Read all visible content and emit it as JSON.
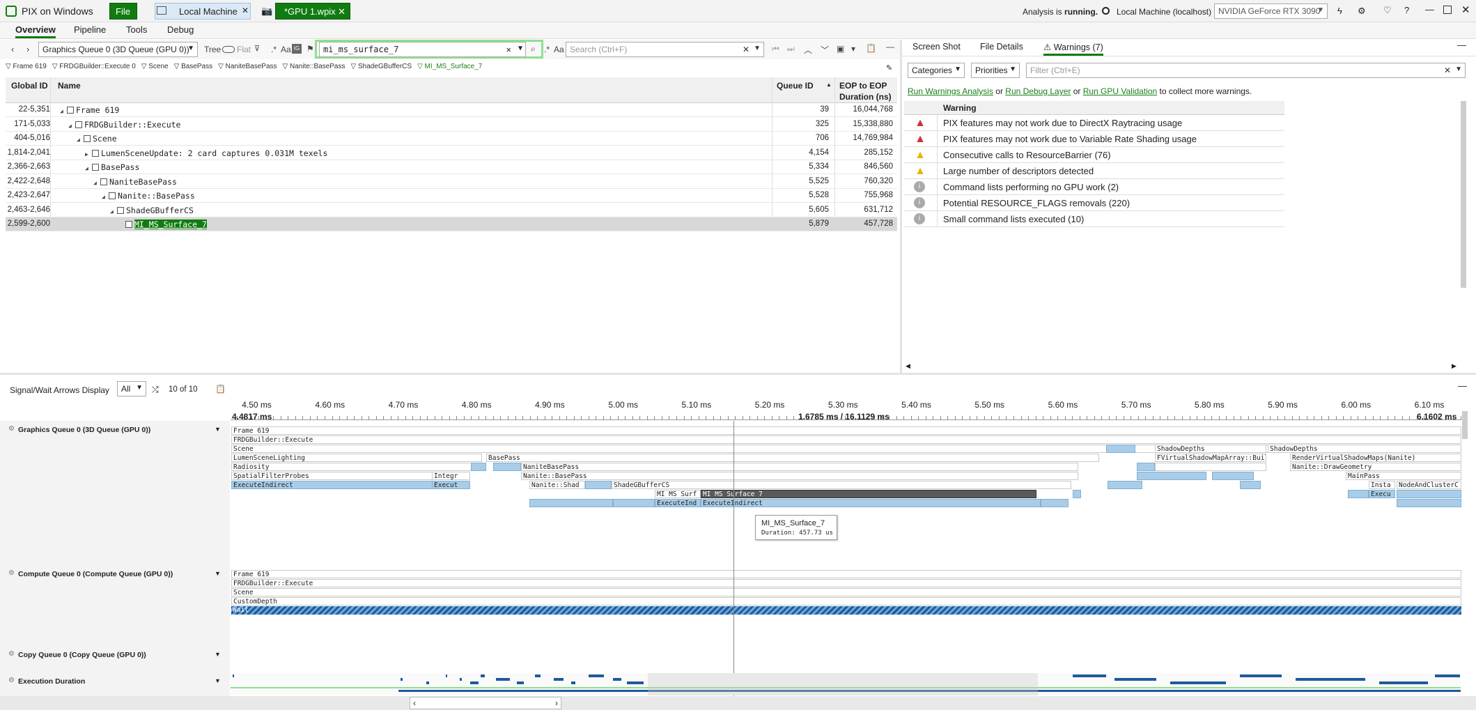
{
  "app": {
    "title": "PIX on Windows",
    "file_btn": "File",
    "tab_local": "Local Machine",
    "tab_capture": "*GPU 1.wpix",
    "status_prefix": "Analysis is ",
    "status_bold": "running.",
    "machine": "Local Machine (localhost)",
    "gpu": "NVIDIA GeForce RTX 3090"
  },
  "menu": {
    "overview": "Overview",
    "pipeline": "Pipeline",
    "tools": "Tools",
    "debug": "Debug"
  },
  "toolbar": {
    "queue": "Graphics Queue 0 (3D Queue (GPU 0))",
    "tree": "Tree",
    "flat": "Flat",
    "regex": ".*",
    "aa": "Aa",
    "search_value": "mi_ms_surface_7",
    "search_placeholder": "Search (Ctrl+F)"
  },
  "breadcrumb": [
    "Frame 619",
    "FRDGBuilder::Execute 0",
    "Scene",
    "BasePass",
    "NaniteBasePass",
    "Nanite::BasePass",
    "ShadeGBufferCS",
    "MI_MS_Surface_7"
  ],
  "table": {
    "headers": {
      "gid": "Global ID",
      "name": "Name",
      "queue": "Queue ID",
      "eop": "EOP to EOP",
      "eop2": "Duration (ns)"
    },
    "rows": [
      {
        "gid": "22-5,351",
        "name": "Frame 619",
        "queue": "39",
        "eop": "16,044,768",
        "depth": 0,
        "exp": true
      },
      {
        "gid": "171-5,033",
        "name": "FRDGBuilder::Execute",
        "queue": "325",
        "eop": "15,338,880",
        "depth": 1,
        "exp": true
      },
      {
        "gid": "404-5,016",
        "name": "Scene",
        "queue": "706",
        "eop": "14,769,984",
        "depth": 2,
        "exp": true
      },
      {
        "gid": "1,814-2,041",
        "name": "LumenSceneUpdate: 2 card captures 0.031M texels",
        "queue": "4,154",
        "eop": "285,152",
        "depth": 3,
        "exp": false
      },
      {
        "gid": "2,366-2,663",
        "name": "BasePass",
        "queue": "5,334",
        "eop": "846,560",
        "depth": 3,
        "exp": true
      },
      {
        "gid": "2,422-2,648",
        "name": "NaniteBasePass",
        "queue": "5,525",
        "eop": "760,320",
        "depth": 4,
        "exp": true
      },
      {
        "gid": "2,423-2,647",
        "name": "Nanite::BasePass",
        "queue": "5,528",
        "eop": "755,968",
        "depth": 5,
        "exp": true
      },
      {
        "gid": "2,463-2,646",
        "name": "ShadeGBufferCS",
        "queue": "5,605",
        "eop": "631,712",
        "depth": 6,
        "exp": true
      },
      {
        "gid": "2,599-2,600",
        "name": "MI_MS_Surface_7",
        "queue": "5,879",
        "eop": "457,728",
        "depth": 7,
        "exp": null,
        "sel": true
      }
    ]
  },
  "right": {
    "tab_screenshot": "Screen Shot",
    "tab_details": "File Details",
    "tab_warnings": "Warnings (7)",
    "categories": "Categories",
    "priorities": "Priorities",
    "filter_placeholder": "Filter (Ctrl+E)",
    "links": {
      "a": "Run Warnings Analysis",
      "or1": " or ",
      "b": "Run Debug Layer",
      "or2": " or ",
      "c": "Run GPU Validation",
      "tail": " to collect more warnings."
    },
    "warn_header": "Warning",
    "warnings": [
      {
        "icon": "error",
        "text": "PIX features may not work due to DirectX Raytracing usage"
      },
      {
        "icon": "error",
        "text": "PIX features may not work due to Variable Rate Shading usage"
      },
      {
        "icon": "warning",
        "text": "Consecutive calls to ResourceBarrier (76)"
      },
      {
        "icon": "warning",
        "text": "Large number of descriptors detected"
      },
      {
        "icon": "info",
        "text": "Command lists performing no GPU work (2)"
      },
      {
        "icon": "info",
        "text": "Potential RESOURCE_FLAGS removals (220)"
      },
      {
        "icon": "info",
        "text": "Small command lists executed (10)"
      }
    ]
  },
  "timeline": {
    "signal_label": "Signal/Wait Arrows Display",
    "signal_value": "All",
    "count": "10 of 10",
    "ticks": [
      "4.50 ms",
      "4.60 ms",
      "4.70 ms",
      "4.80 ms",
      "4.90 ms",
      "5.00 ms",
      "5.10 ms",
      "5.20 ms",
      "5.30 ms",
      "5.40 ms",
      "5.50 ms",
      "5.60 ms",
      "5.70 ms",
      "5.80 ms",
      "5.90 ms",
      "6.00 ms",
      "6.10 ms"
    ],
    "range_start": "4.4817 ms",
    "range_mid": "1.6785 ms / 16.1129 ms",
    "range_end": "6.1602 ms",
    "gfx_queue": "Graphics Queue 0 (3D Queue (GPU 0))",
    "compute_queue": "Compute Queue 0 (Compute Queue (GPU 0))",
    "copy_queue": "Copy Queue 0 (Copy Queue (GPU 0))",
    "exec_duration": "Execution Duration",
    "gfx_rows": [
      "Frame 619",
      "FRDGBuilder::Execute",
      "Scene",
      "LumenSceneLighting",
      "Radiosity",
      "SpatialFilterProbes",
      "ExecuteIndirect"
    ],
    "labels": {
      "integr": "Integr",
      "execut": "Execut",
      "basepass": "BasePass",
      "nanitebasepass": "NaniteBasePass",
      "nanite_basepass": "Nanite::BasePass",
      "nanite_shad": "Nanite::Shad",
      "shadegbuffer": "ShadeGBufferCS",
      "mi_surf": "MI_MS_Surf",
      "mi_surface7": "MI_MS_Surface_7",
      "execind": "ExecuteInd",
      "executeindirect": "ExecuteIndirect",
      "shadowdepths1": "ShadowDepths",
      "shadowdepths2": "ShadowDepths",
      "fvirtual": "FVirtualShadowMapArray::Buil",
      "rendervirtual": "RenderVirtualShadowMaps(Nanite)",
      "drawgeom": "Nanite::DrawGeometry",
      "mainpass": "MainPass",
      "insta": "Insta",
      "nodeandcluster": "NodeAndClusterC",
      "execu": "Execu"
    },
    "tooltip_title": "MI_MS_Surface_7",
    "tooltip_dur": "Duration: 457.73 us",
    "compute_rows": [
      "Frame 619",
      "FRDGBuilder::Execute",
      "Scene",
      "CustomDepth",
      "Wait"
    ]
  }
}
